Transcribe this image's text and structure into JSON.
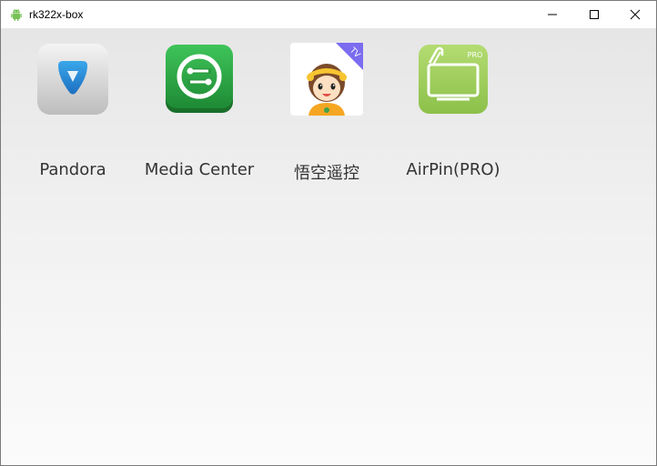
{
  "window": {
    "title": "rk322x-box",
    "title_icon": "android-icon",
    "controls": [
      "minimize-icon",
      "maximize-icon",
      "close-icon"
    ]
  },
  "apps": [
    {
      "label": "Pandora",
      "icon": "pandora-icon"
    },
    {
      "label": "Media Center",
      "icon": "media-center-icon"
    },
    {
      "label": "悟空遥控",
      "icon": "wukong-remote-icon",
      "badge": "TV"
    },
    {
      "label": "AirPin(PRO)",
      "icon": "airpin-pro-icon",
      "badge": "PRO"
    }
  ],
  "colors": {
    "android_green": "#78c257",
    "media_green": "#2a9b3f",
    "airpin_green": "#9ccc5a",
    "pandora_blue": "#2f8fd6",
    "tv_badge": "#7b6cf0"
  }
}
